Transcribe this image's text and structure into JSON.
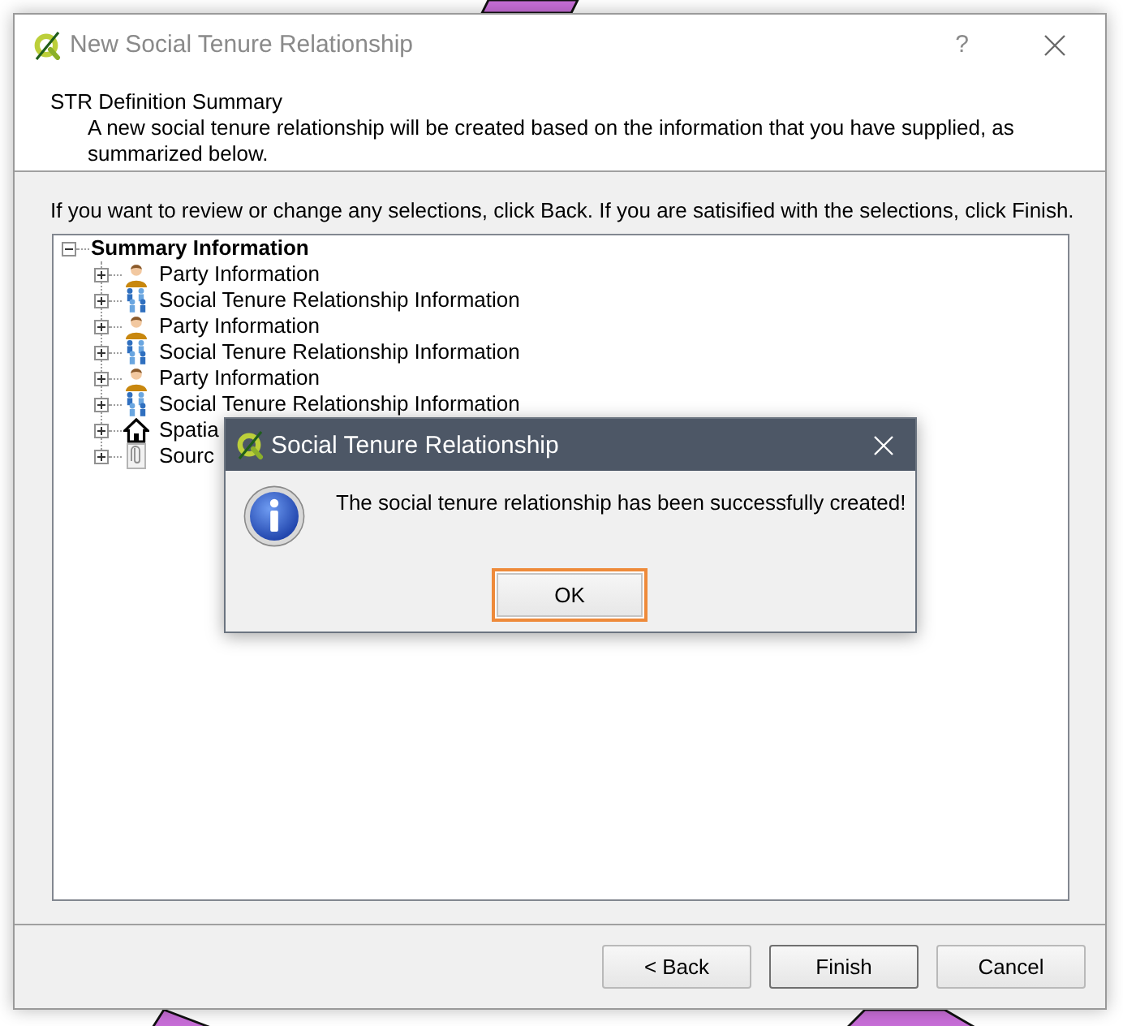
{
  "window": {
    "title": "New Social Tenure Relationship",
    "help": "?"
  },
  "page": {
    "title": "STR Definition Summary",
    "subtitle": "A new social tenure relationship will be created based on the information that you have supplied, as summarized below."
  },
  "instruction": "If you want to review or change any selections, click Back. If you are satisified with the selections, click Finish.",
  "tree": {
    "items": [
      {
        "label": "Summary Information",
        "expanded": true,
        "children": [
          {
            "kind": "person",
            "label": "Party Information",
            "expanded": false
          },
          {
            "kind": "people",
            "label": "Social Tenure Relationship Information",
            "expanded": false
          },
          {
            "kind": "person",
            "label": "Party Information",
            "expanded": false
          },
          {
            "kind": "people",
            "label": "Social Tenure Relationship Information",
            "expanded": false
          },
          {
            "kind": "person",
            "label": "Party Information",
            "expanded": false
          },
          {
            "kind": "people",
            "label": "Social Tenure Relationship Information",
            "expanded": false
          },
          {
            "kind": "house",
            "label": "Spatia",
            "expanded": false
          },
          {
            "kind": "document",
            "label": "Sourc",
            "expanded": false
          }
        ]
      }
    ]
  },
  "buttons": [
    {
      "label": "< Back",
      "default": false
    },
    {
      "label": "Finish",
      "default": true
    },
    {
      "label": "Cancel",
      "default": false
    }
  ],
  "message_box": {
    "title": "Social Tenure Relationship",
    "text": "The social tenure relationship has been successfully created!",
    "buttons": [
      {
        "label": "OK",
        "focused": true
      }
    ]
  }
}
